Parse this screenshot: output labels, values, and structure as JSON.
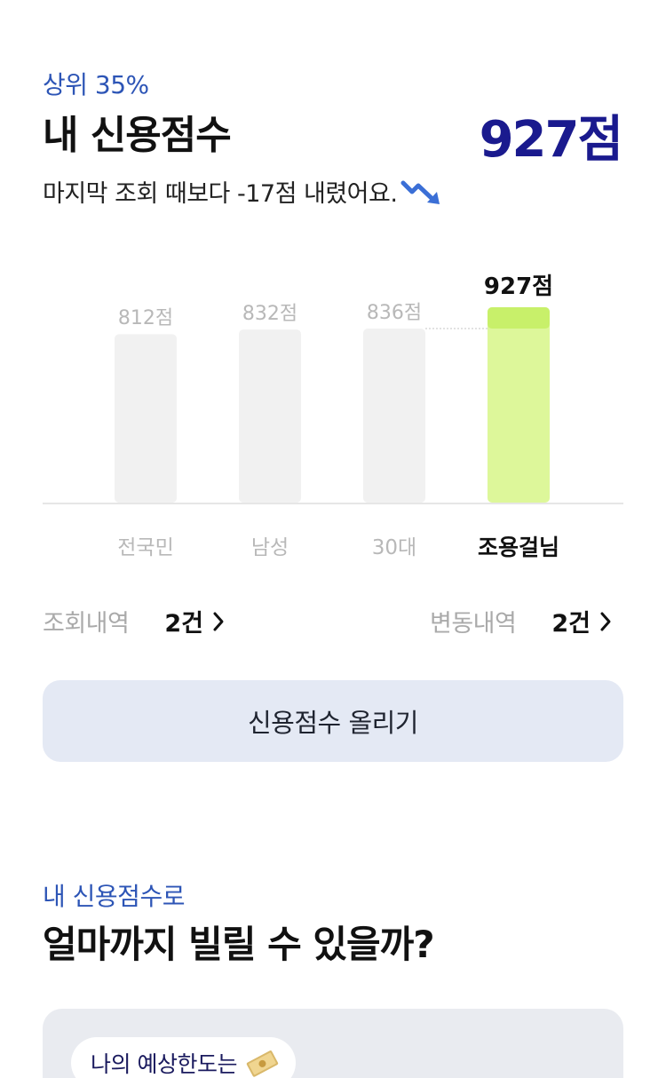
{
  "header": {
    "rank_text": "상위 35%",
    "title": "내 신용점수",
    "score": "927점",
    "change_text": "마지막 조회 때보다 -17점 내렸어요.",
    "change_icon": "trend-down-icon"
  },
  "chart_data": {
    "type": "bar",
    "categories": [
      "전국민",
      "남성",
      "30대",
      "조용걸님"
    ],
    "values": [
      812,
      832,
      836,
      927
    ],
    "value_labels": [
      "812점",
      "832점",
      "836점",
      "927점"
    ],
    "highlight_index": 3,
    "colors": {
      "default_bar": "#f1f1f1",
      "highlight_bar": "#ddf79a",
      "highlight_top": "#c8f06a",
      "reference_line": "#d8d8d8",
      "axis": "#e6e6e6"
    }
  },
  "stats": {
    "inquiry_label": "조회내역",
    "inquiry_value": "2건",
    "change_label": "변동내역",
    "change_value": "2건"
  },
  "raise_button_label": "신용점수 올리기",
  "loan_section": {
    "kicker": "내 신용점수로",
    "title": "얼마까지 빌릴 수 있을까?",
    "pill_text": "나의 예상한도는",
    "pill_icon": "money-icon"
  },
  "colors": {
    "accent": "#2d55b6",
    "score": "#1a1a8e",
    "button_bg": "#e4e9f4"
  }
}
